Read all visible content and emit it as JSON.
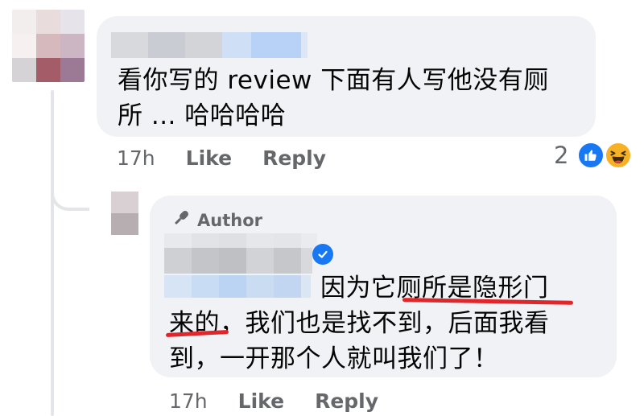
{
  "colors": {
    "bubble_bg": "#f0f2f5",
    "secondary_text": "#65676b",
    "facebook_blue": "#1877f2",
    "haha_yellow": "#f7b125",
    "annotation_red": "#e0262b"
  },
  "main_comment": {
    "author_name": "",
    "text_line1": "看你写的 review 下面有人写他没有厕",
    "text_line2": "所 ... 哈哈哈哈",
    "timestamp": "17h",
    "like_label": "Like",
    "reply_label": "Reply",
    "reaction_count": "2",
    "reaction_icons": [
      "like-reaction-icon",
      "haha-reaction-icon"
    ]
  },
  "reply_comment": {
    "badge_label": "Author",
    "badge_icon": "microphone-icon",
    "author_name": "",
    "verified_icon": "verified-badge-icon",
    "text_line1": "因为它厕所是隐形门",
    "text_line2": "来的，我们也是找不到，后面我看",
    "text_line3": "到，一开那个人就叫我们了！",
    "timestamp": "17h",
    "like_label": "Like",
    "reply_label": "Reply"
  }
}
